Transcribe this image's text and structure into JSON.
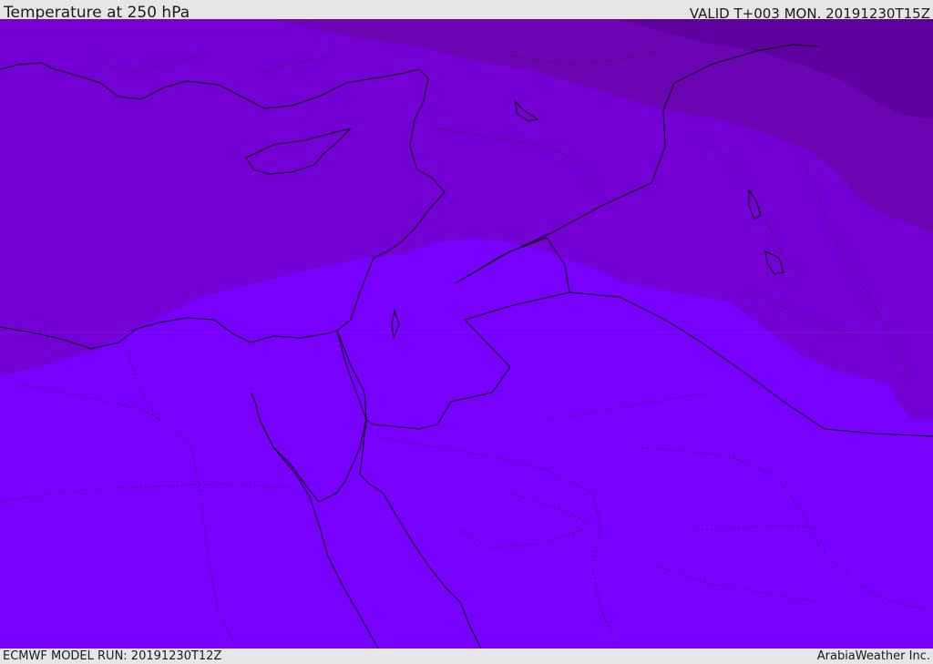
{
  "header": {
    "title": "Temperature at 250 hPa",
    "valid_time": "VALID T+003 MON. 20191230T15Z"
  },
  "footer": {
    "model_run": "ECMWF MODEL RUN: 20191230T12Z",
    "credit": "ArabiaWeather Inc."
  },
  "map": {
    "variable": "temperature",
    "pressure_level_hpa": 250,
    "colors": {
      "coldest": "#5e009f",
      "colder": "#6b05b4",
      "cold": "#7500d6",
      "mild": "#7700ff",
      "coastline": "#000000",
      "borders": "#000000"
    },
    "icons": {
      "coastline": "coastline-lines",
      "borders": "dotted-border-lines"
    }
  }
}
